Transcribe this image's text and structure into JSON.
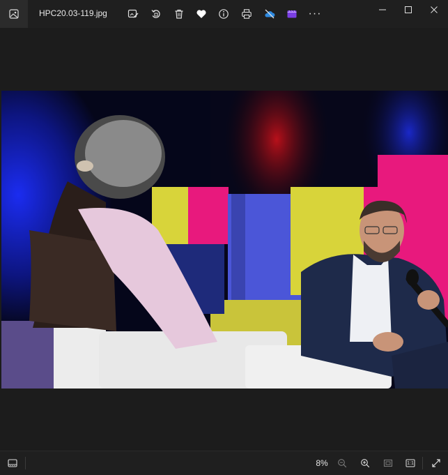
{
  "window": {
    "filename": "HPC20.03-119.jpg"
  },
  "toolbar": {
    "tools": [
      {
        "name": "edit-image-icon"
      },
      {
        "name": "rotate-icon"
      },
      {
        "name": "delete-icon"
      },
      {
        "name": "favorite-heart-icon"
      },
      {
        "name": "info-icon"
      },
      {
        "name": "print-icon"
      },
      {
        "name": "onedrive-cloud-icon"
      },
      {
        "name": "clipchamp-video-icon"
      },
      {
        "name": "more-options-icon"
      }
    ],
    "more_label": "···"
  },
  "window_controls": {
    "minimize": "—",
    "maximize": "☐",
    "close": "✕"
  },
  "status": {
    "zoom": "8%",
    "actual_size_label": "1:1"
  },
  "colors": {
    "background": "#1c1c1c",
    "titlebar": "#1f1f1f",
    "accent_pink": "#e8197d",
    "accent_yellow": "#d8d43a",
    "accent_blue": "#4b56d8",
    "heart": "#ffffff"
  }
}
